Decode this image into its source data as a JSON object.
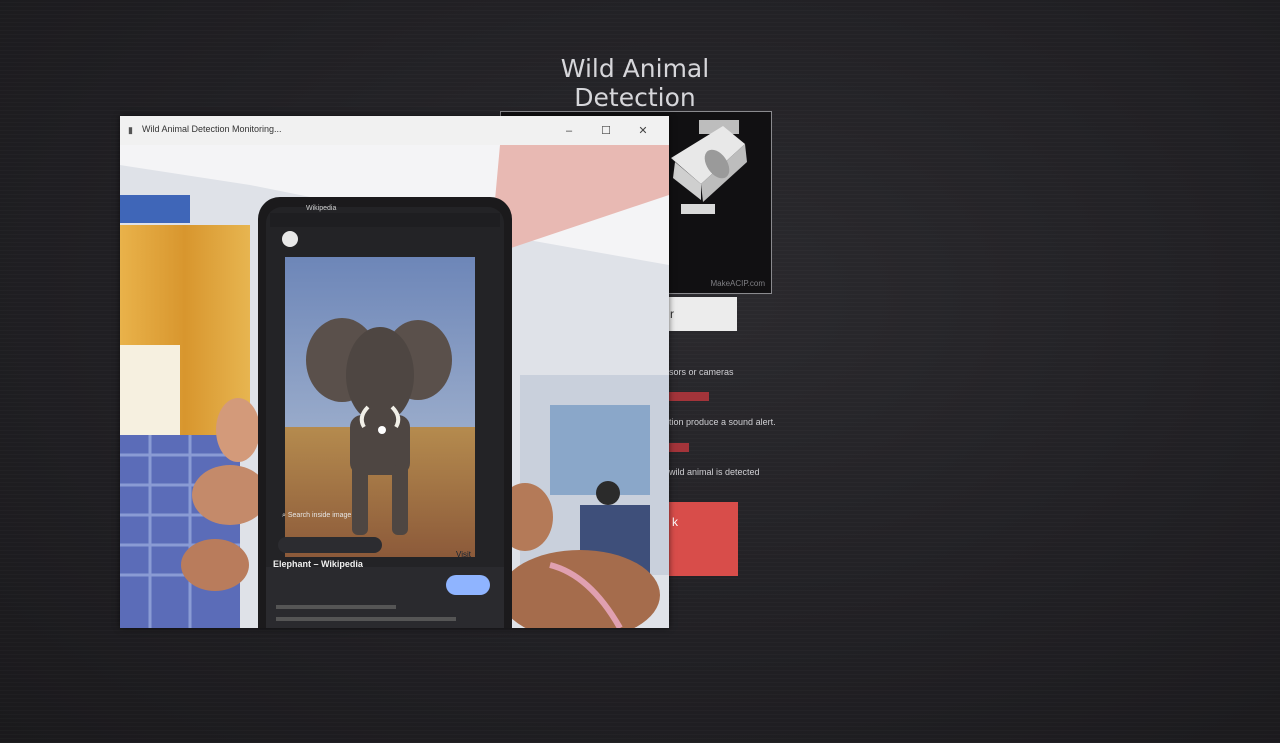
{
  "page": {
    "top_cut_text": "",
    "title": "Wild Animal Detection"
  },
  "camera_panel": {
    "watermark": "MakeACIP.com"
  },
  "controls": {
    "white_button_label": "r",
    "red_button_label": "k",
    "descriptions": [
      "sors or cameras",
      "tion produce a sound alert.",
      "wild animal is detected"
    ],
    "red_labels": [
      "",
      ""
    ]
  },
  "monitor_window": {
    "title": "Wild Animal Detection Monitoring...",
    "minimize_label": "–",
    "maximize_label": "☐",
    "close_label": "✕"
  },
  "phone": {
    "app_label": "Wikipedia",
    "search_label": "Search inside image",
    "result_title": "Elephant – Wikipedia",
    "visit_label": "Visit",
    "detail_lines": [
      "",
      "",
      ""
    ]
  },
  "colors": {
    "background": "#1e1d20",
    "accent_red": "#d84d4a",
    "window_bg": "#f3f3f3"
  }
}
